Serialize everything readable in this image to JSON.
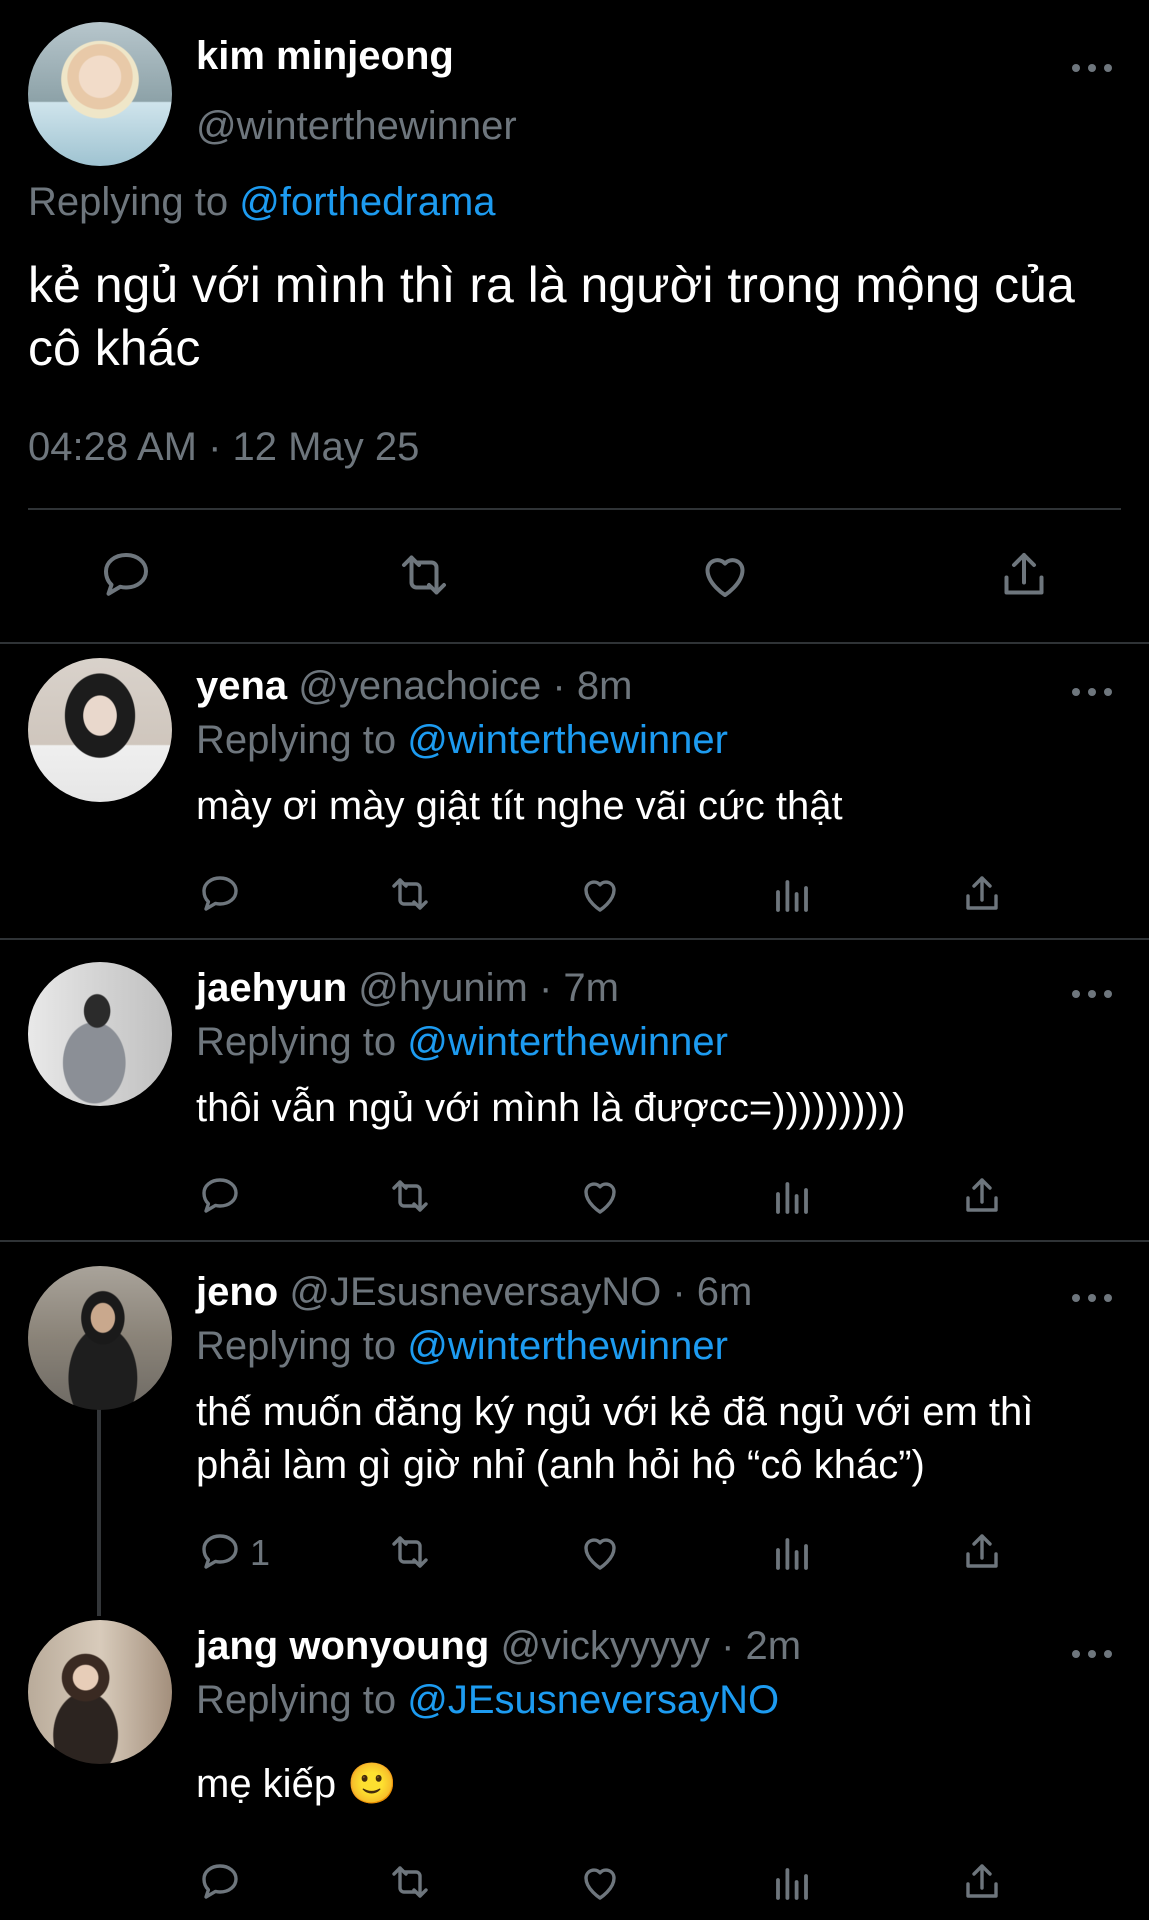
{
  "main_tweet": {
    "name": "kim minjeong",
    "handle": "@winterthewinner",
    "replying_label": "Replying to",
    "replying_to": "@forthedrama",
    "text": "kẻ ngủ với mình thì ra là người trong mộng của cô khác",
    "timestamp": "04:28 AM · 12 May 25",
    "actions": [
      "comment-icon",
      "retweet-icon",
      "like-icon",
      "share-icon"
    ]
  },
  "replies": [
    {
      "name": "yena",
      "handle": "@yenachoice",
      "time": "· 8m",
      "replying_label": "Replying to",
      "replying_to": "@winterthewinner",
      "text": "mày ơi mày giật tít nghe vãi cức thật",
      "reply_count": ""
    },
    {
      "name": "jaehyun",
      "handle": "@hyunim",
      "time": "· 7m",
      "replying_label": "Replying to",
      "replying_to": "@winterthewinner",
      "text": "thôi vẫn ngủ với mình là đượcc=))))))))))",
      "reply_count": ""
    },
    {
      "name": "jeno",
      "handle": "@JEsusneversayNO",
      "time": "· 6m",
      "replying_label": "Replying to",
      "replying_to": "@winterthewinner",
      "text": "thế muốn đăng ký ngủ với kẻ đã ngủ với em thì phải làm gì giờ nhỉ (anh hỏi hộ “cô khác”)",
      "reply_count": "1"
    },
    {
      "name": "jang wonyoung",
      "handle": "@vickyyyyy",
      "time": "· 2m",
      "replying_label": "Replying to",
      "replying_to": "@JEsusneversayNO",
      "text": "mẹ kiếp 🙂",
      "reply_count": ""
    }
  ],
  "colors": {
    "background": "#000000",
    "text": "#e7e9ea",
    "muted": "#6e767d",
    "link": "#1d9bf0",
    "divider": "#2f3336"
  }
}
